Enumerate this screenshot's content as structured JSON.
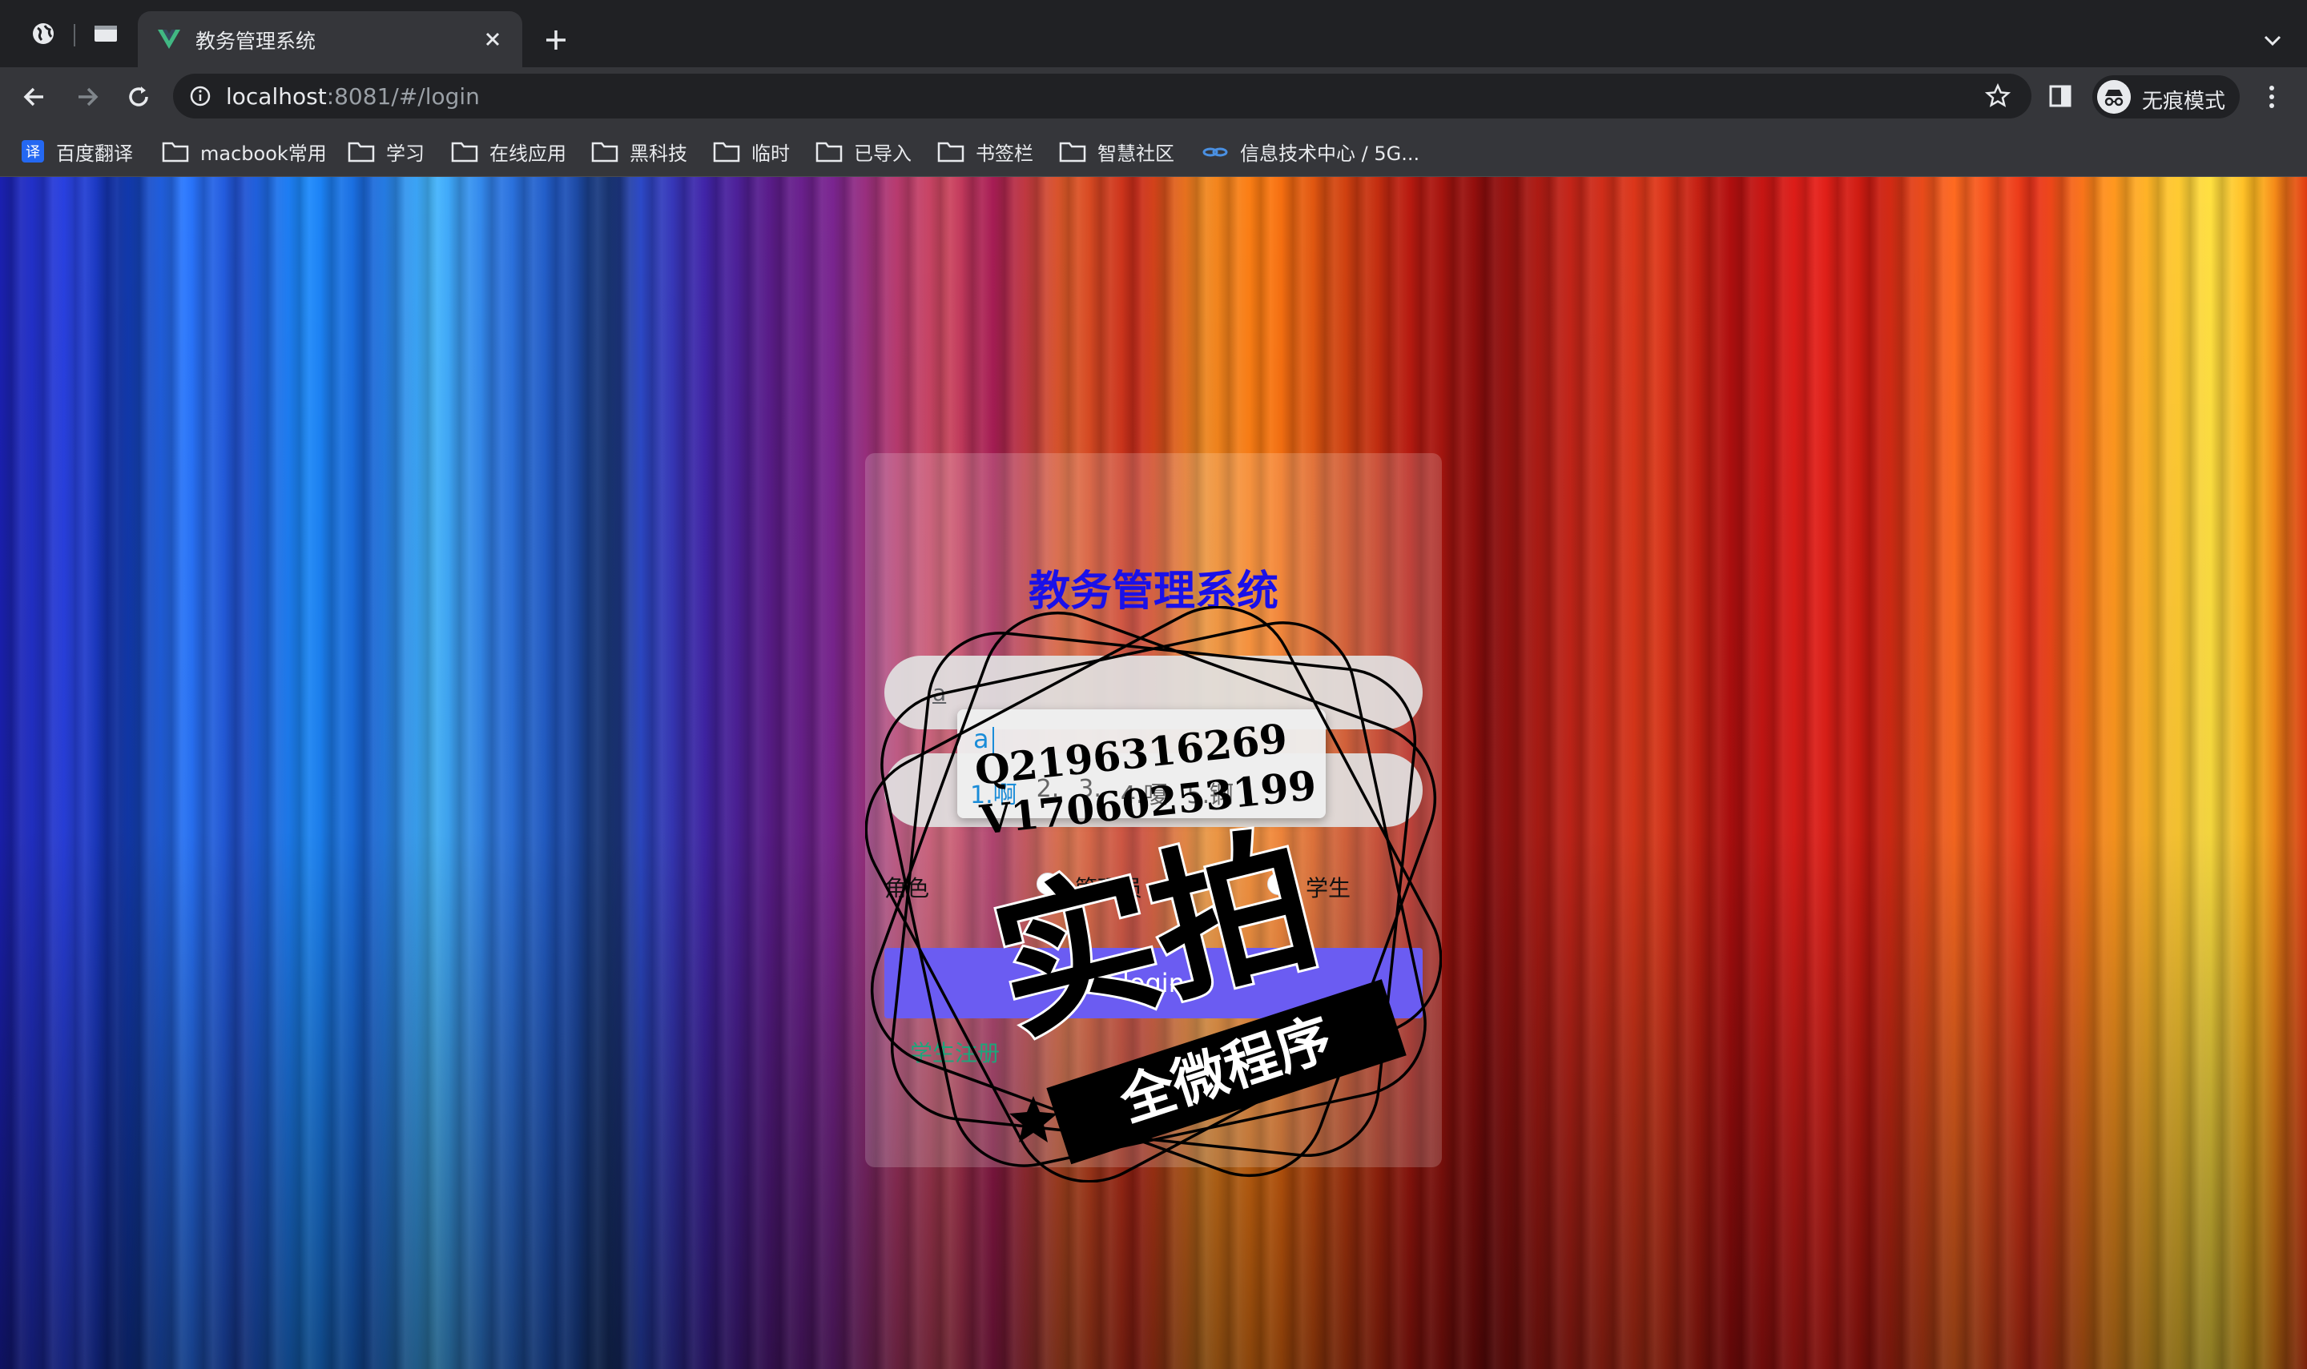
{
  "browser": {
    "tab_title": "教务管理系统",
    "url_host": "localhost",
    "url_rest": ":8081/#/login",
    "incognito_label": "无痕模式"
  },
  "bookmarks": [
    {
      "label": "百度翻译",
      "icon": "translate-icon"
    },
    {
      "label": "macbook常用",
      "icon": "folder-icon"
    },
    {
      "label": "学习",
      "icon": "folder-icon"
    },
    {
      "label": "在线应用",
      "icon": "folder-icon"
    },
    {
      "label": "黑科技",
      "icon": "folder-icon"
    },
    {
      "label": "临时",
      "icon": "folder-icon"
    },
    {
      "label": "已导入",
      "icon": "folder-icon"
    },
    {
      "label": "书签栏",
      "icon": "folder-icon"
    },
    {
      "label": "智慧社区",
      "icon": "folder-icon"
    },
    {
      "label": "信息技术中心 / 5G...",
      "icon": "link-icon"
    }
  ],
  "login": {
    "title": "教务管理系统",
    "username_value": "a",
    "ime": {
      "composition": "a",
      "candidates": [
        "1.啊",
        "2.",
        "3.",
        "4.嗄",
        "5.锕"
      ]
    },
    "role_label": "角色",
    "role_options": [
      "管理员",
      "学生"
    ],
    "login_button": "login",
    "register_link": "学生注册"
  },
  "watermark": {
    "qq_line": "Q2196316269",
    "v_line": "V17060253199",
    "big_text": "实拍",
    "banner_text": "全微程序"
  },
  "colors": {
    "title_blue": "#1a10e8",
    "login_button": "#6b5cf2",
    "register_link": "#1ea57a",
    "ime_highlight": "#1a8cd8"
  }
}
